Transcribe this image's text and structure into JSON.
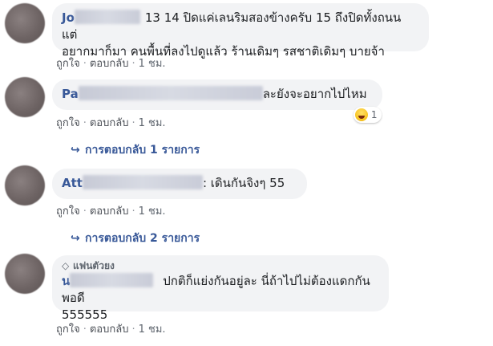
{
  "comments": [
    {
      "author_visible": "Jo",
      "text_line1": "13 14 ปิดแค่เลนริมสองข้างครับ 15 ถึงปิดทั้งถนน แต่",
      "text_line2": "อยากมาก็มา คนพื้นที่ลงไปดูแล้ว ร้านเดิมๆ รสชาติเดิมๆ บายจ้า",
      "like": "ถูกใจ",
      "reply": "ตอบกลับ",
      "time": "1 ชม."
    },
    {
      "author_visible": "Pa",
      "text": "ละยังจะอยากไปไหม",
      "reaction_count": "1",
      "like": "ถูกใจ",
      "reply": "ตอบกลับ",
      "time": "1 ชม.",
      "replies_label": "การตอบกลับ 1 รายการ"
    },
    {
      "author_visible": "Att",
      "text": ": เดินกันจิงๆ 55",
      "like": "ถูกใจ",
      "reply": "ตอบกลับ",
      "time": "1 ชม.",
      "replies_label": "การตอบกลับ 2 รายการ"
    },
    {
      "badge": "แฟนตัวยง",
      "author_visible": "น",
      "text_line1": "ปกติก็แย่งกันอยู่ละ นี่ถ้าไปไม่ต้องแดกกันพอดี",
      "text_line2": "555555",
      "like": "ถูกใจ",
      "reply": "ตอบกลับ",
      "time": "1 ชม."
    }
  ],
  "separator": "·",
  "icons": {
    "reply_arrow": "reply-arrow-icon",
    "badge": "diamond-icon",
    "reaction": "haha-icon"
  },
  "colors": {
    "bubble": "#f2f3f5",
    "name": "#385898",
    "meta": "#606770"
  }
}
